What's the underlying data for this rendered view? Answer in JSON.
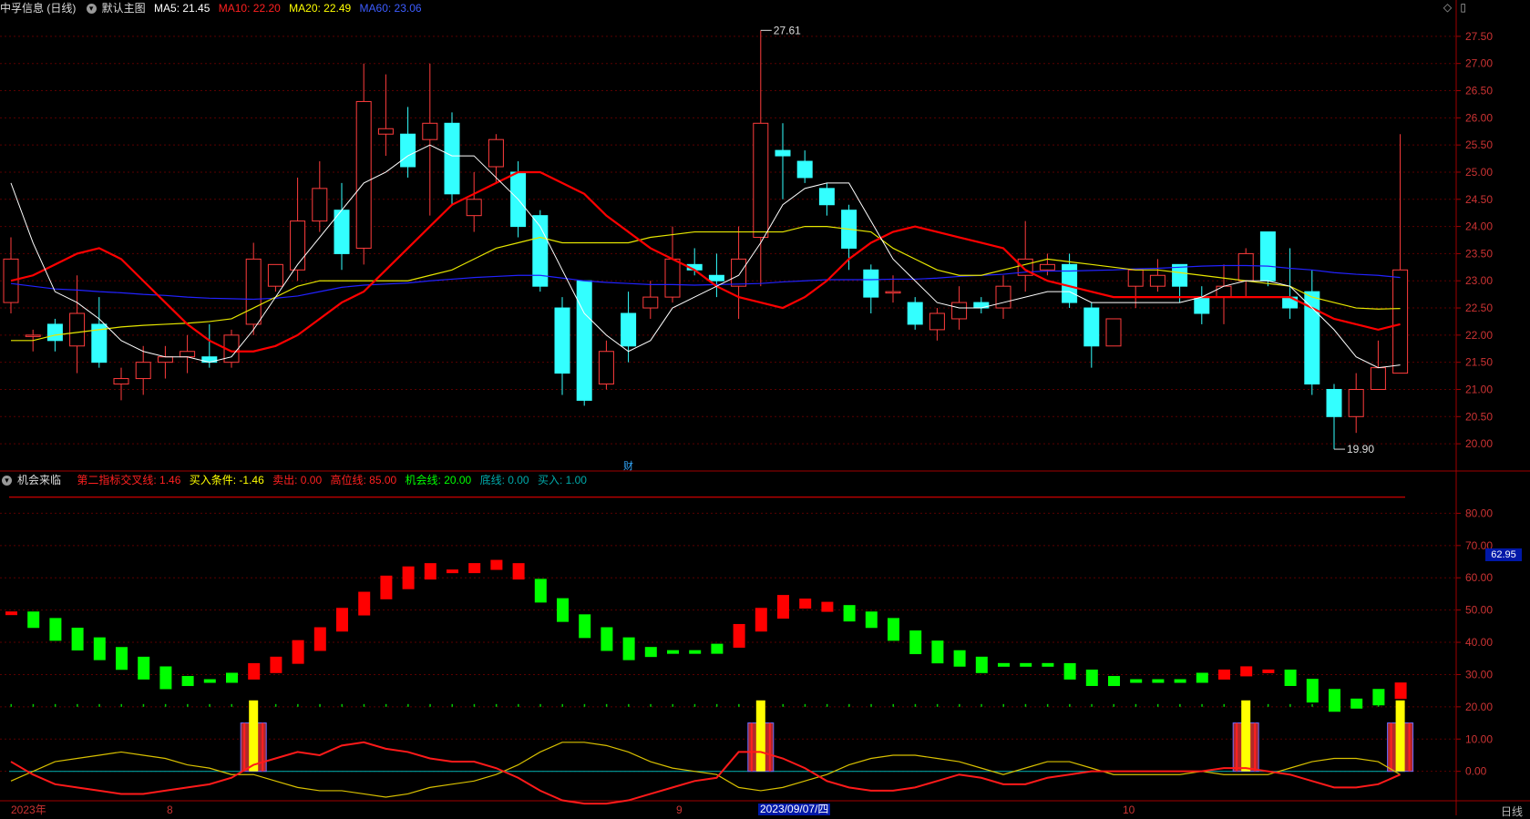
{
  "header": {
    "stock_title": "中孚信息 (日线)",
    "main_chart_label": "默认主图",
    "ma5": "MA5: 21.45",
    "ma10": "MA10: 22.20",
    "ma20": "MA20: 22.49",
    "ma60": "MA60: 23.06",
    "icons": [
      "diamond-icon",
      "window-icon"
    ]
  },
  "indicator_header": {
    "name": "机会来临",
    "cross_line": "第二指标交叉线: 1.46",
    "buy_condition": "买入条件: -1.46",
    "sell": "卖出: 0.00",
    "high_line": "高位线: 85.00",
    "chance_line": "机会线: 20.00",
    "bottom_line": "底线: 0.00",
    "buy": "买入: 1.00"
  },
  "price_axis": [
    "27.50",
    "27.00",
    "26.50",
    "26.00",
    "25.50",
    "25.00",
    "24.50",
    "24.00",
    "23.50",
    "23.00",
    "22.50",
    "22.00",
    "21.50",
    "21.00",
    "20.50",
    "20.00"
  ],
  "indicator_axis": [
    "80.00",
    "70.00",
    "60.00",
    "50.00",
    "40.00",
    "30.00",
    "20.00",
    "10.00",
    "0.00"
  ],
  "annotations": {
    "high": "27.61",
    "low": "19.90",
    "event_mark": "财",
    "current_value": "62.95"
  },
  "x_axis": {
    "labels": [
      "2023年",
      "8",
      "9",
      "10"
    ],
    "cursor_date": "2023/09/07/四",
    "period": "日线"
  },
  "colors": {
    "up": "#ff3c3c",
    "down": "#33ffff",
    "ma5": "#ffffff",
    "ma10": "#ff0000",
    "ma20": "#e6e600",
    "ma60": "#2222ff",
    "grid": "#5a0000",
    "ind_up": "#ff0000",
    "ind_down": "#00ff00"
  },
  "chart_data": {
    "type": "candlestick",
    "ylim": [
      19.7,
      27.8
    ],
    "candles": [
      [
        22.6,
        23.4,
        23.8,
        22.4
      ],
      [
        22.0,
        22.0,
        22.1,
        21.7
      ],
      [
        22.2,
        21.9,
        22.3,
        21.7
      ],
      [
        21.8,
        22.4,
        23.1,
        21.3
      ],
      [
        22.2,
        21.5,
        22.7,
        21.4
      ],
      [
        21.1,
        21.2,
        21.4,
        20.8
      ],
      [
        21.2,
        21.5,
        21.8,
        20.9
      ],
      [
        21.5,
        21.6,
        21.8,
        21.2
      ],
      [
        21.6,
        21.7,
        22.0,
        21.3
      ],
      [
        21.6,
        21.5,
        22.2,
        21.4
      ],
      [
        21.5,
        22.0,
        22.1,
        21.4
      ],
      [
        22.2,
        23.4,
        23.7,
        22.0
      ],
      [
        22.9,
        23.3,
        23.3,
        22.8
      ],
      [
        23.2,
        24.1,
        24.9,
        23.0
      ],
      [
        24.1,
        24.7,
        25.2,
        23.9
      ],
      [
        24.3,
        23.5,
        24.8,
        23.2
      ],
      [
        23.6,
        26.3,
        27.0,
        23.3
      ],
      [
        25.7,
        25.8,
        26.8,
        25.3
      ],
      [
        25.7,
        25.1,
        26.2,
        24.9
      ],
      [
        25.6,
        25.9,
        27.0,
        24.2
      ],
      [
        25.9,
        24.6,
        26.1,
        24.4
      ],
      [
        24.2,
        24.5,
        25.0,
        23.9
      ],
      [
        25.1,
        25.6,
        25.7,
        24.8
      ],
      [
        25.0,
        24.0,
        25.2,
        23.8
      ],
      [
        24.2,
        22.9,
        24.3,
        22.8
      ],
      [
        22.5,
        21.3,
        22.7,
        20.9
      ],
      [
        23.0,
        20.8,
        23.0,
        20.7
      ],
      [
        21.1,
        21.7,
        21.9,
        21.0
      ],
      [
        22.4,
        21.8,
        22.8,
        21.5
      ],
      [
        22.5,
        22.7,
        23.0,
        22.3
      ],
      [
        22.7,
        23.4,
        24.0,
        22.6
      ],
      [
        23.3,
        23.2,
        23.6,
        23.1
      ],
      [
        23.1,
        23.0,
        23.5,
        22.7
      ],
      [
        22.9,
        23.4,
        24.0,
        22.3
      ],
      [
        23.8,
        25.9,
        27.61,
        22.9
      ],
      [
        25.4,
        25.3,
        25.9,
        24.5
      ],
      [
        25.2,
        24.9,
        25.4,
        24.8
      ],
      [
        24.7,
        24.4,
        24.8,
        24.2
      ],
      [
        24.3,
        23.6,
        24.4,
        23.2
      ],
      [
        23.2,
        22.7,
        23.3,
        22.4
      ],
      [
        22.8,
        22.8,
        23.1,
        22.6
      ],
      [
        22.6,
        22.2,
        22.7,
        22.1
      ],
      [
        22.1,
        22.4,
        22.5,
        21.9
      ],
      [
        22.3,
        22.6,
        22.9,
        22.1
      ],
      [
        22.6,
        22.5,
        22.7,
        22.4
      ],
      [
        22.5,
        22.9,
        23.1,
        22.3
      ],
      [
        23.1,
        23.4,
        24.1,
        22.8
      ],
      [
        23.2,
        23.3,
        23.5,
        23.1
      ],
      [
        23.3,
        22.6,
        23.5,
        22.5
      ],
      [
        22.5,
        21.8,
        22.6,
        21.4
      ],
      [
        21.8,
        22.3,
        22.3,
        21.8
      ],
      [
        22.9,
        23.2,
        23.2,
        22.5
      ],
      [
        22.9,
        23.1,
        23.4,
        22.8
      ],
      [
        23.3,
        22.9,
        23.3,
        22.6
      ],
      [
        22.7,
        22.4,
        22.9,
        22.2
      ],
      [
        22.7,
        22.9,
        23.3,
        22.2
      ],
      [
        23.0,
        23.5,
        23.6,
        22.7
      ],
      [
        23.9,
        23.0,
        23.9,
        22.9
      ],
      [
        22.7,
        22.5,
        23.6,
        22.3
      ],
      [
        22.8,
        21.1,
        23.2,
        20.9
      ],
      [
        21.0,
        20.5,
        21.1,
        19.9
      ],
      [
        20.5,
        21.0,
        21.3,
        20.2
      ],
      [
        21.0,
        21.4,
        21.9,
        21.0
      ],
      [
        21.3,
        23.2,
        25.7,
        21.3
      ]
    ],
    "ma5": [
      24.8,
      23.7,
      22.8,
      22.6,
      22.3,
      21.9,
      21.7,
      21.6,
      21.6,
      21.5,
      21.6,
      22.1,
      22.7,
      23.3,
      23.8,
      24.3,
      24.8,
      25.0,
      25.3,
      25.5,
      25.3,
      25.3,
      24.9,
      24.5,
      24.0,
      23.2,
      22.4,
      22.0,
      21.7,
      21.9,
      22.5,
      22.7,
      22.9,
      23.1,
      23.7,
      24.4,
      24.7,
      24.8,
      24.8,
      24.1,
      23.4,
      23.0,
      22.6,
      22.5,
      22.5,
      22.6,
      22.7,
      22.8,
      22.8,
      22.6,
      22.6,
      22.6,
      22.6,
      22.6,
      22.7,
      22.9,
      23.0,
      23.0,
      22.9,
      22.5,
      22.1,
      21.6,
      21.4,
      21.45
    ],
    "ma10": [
      23.0,
      23.1,
      23.3,
      23.5,
      23.6,
      23.4,
      23.0,
      22.6,
      22.2,
      21.9,
      21.7,
      21.7,
      21.8,
      22.0,
      22.3,
      22.6,
      22.8,
      23.2,
      23.6,
      24.0,
      24.4,
      24.6,
      24.8,
      25.0,
      25.0,
      24.8,
      24.6,
      24.2,
      23.9,
      23.6,
      23.4,
      23.2,
      22.9,
      22.7,
      22.6,
      22.5,
      22.7,
      23.0,
      23.4,
      23.7,
      23.9,
      24.0,
      23.9,
      23.8,
      23.7,
      23.6,
      23.2,
      23.0,
      22.9,
      22.8,
      22.7,
      22.7,
      22.7,
      22.7,
      22.7,
      22.7,
      22.7,
      22.7,
      22.7,
      22.5,
      22.3,
      22.2,
      22.1,
      22.2
    ],
    "ma20": [
      21.9,
      21.9,
      22.0,
      22.05,
      22.1,
      22.15,
      22.18,
      22.2,
      22.22,
      22.25,
      22.3,
      22.5,
      22.7,
      22.9,
      23.0,
      23.0,
      23.0,
      23.0,
      23.0,
      23.1,
      23.2,
      23.4,
      23.6,
      23.7,
      23.8,
      23.7,
      23.7,
      23.7,
      23.7,
      23.8,
      23.85,
      23.9,
      23.9,
      23.9,
      23.9,
      23.9,
      24.0,
      24.0,
      23.95,
      23.9,
      23.6,
      23.4,
      23.2,
      23.1,
      23.1,
      23.2,
      23.3,
      23.4,
      23.35,
      23.3,
      23.25,
      23.2,
      23.2,
      23.15,
      23.1,
      23.05,
      23.0,
      22.95,
      22.9,
      22.7,
      22.6,
      22.5,
      22.48,
      22.49
    ],
    "ma60": [
      22.95,
      22.9,
      22.85,
      22.83,
      22.8,
      22.78,
      22.75,
      22.73,
      22.7,
      22.68,
      22.67,
      22.66,
      22.68,
      22.72,
      22.8,
      22.88,
      22.92,
      22.94,
      22.96,
      23.0,
      23.03,
      23.06,
      23.08,
      23.1,
      23.1,
      23.05,
      23.0,
      22.97,
      22.95,
      22.93,
      22.93,
      22.92,
      22.93,
      22.94,
      22.95,
      22.98,
      23.0,
      23.02,
      23.02,
      23.02,
      23.03,
      23.03,
      23.05,
      23.08,
      23.1,
      23.12,
      23.16,
      23.18,
      23.18,
      23.19,
      23.2,
      23.22,
      23.23,
      23.25,
      23.27,
      23.28,
      23.28,
      23.27,
      23.23,
      23.2,
      23.15,
      23.12,
      23.1,
      23.06
    ],
    "indicator": {
      "ylim": [
        -8,
        90
      ],
      "bars": [
        49,
        47,
        44,
        41,
        38,
        35,
        32,
        29,
        28,
        28,
        29,
        31,
        33,
        37,
        41,
        47,
        52,
        57,
        60,
        62,
        62,
        63,
        64,
        62,
        56,
        50,
        45,
        41,
        38,
        37,
        37,
        37,
        38,
        42,
        47,
        51,
        52,
        51,
        49,
        47,
        44,
        40,
        37,
        35,
        33,
        33,
        33,
        33,
        31,
        29,
        28,
        28,
        28,
        28,
        29,
        30,
        31,
        31,
        29,
        25,
        22,
        21,
        23,
        25
      ],
      "bar_up": [
        1,
        0,
        0,
        0,
        0,
        0,
        0,
        0,
        0,
        0,
        0,
        1,
        1,
        1,
        1,
        1,
        1,
        1,
        1,
        1,
        1,
        1,
        1,
        1,
        0,
        0,
        0,
        0,
        0,
        0,
        0,
        0,
        0,
        1,
        1,
        1,
        1,
        1,
        0,
        0,
        0,
        0,
        0,
        0,
        0,
        0,
        0,
        0,
        0,
        0,
        0,
        0,
        0,
        0,
        0,
        1,
        1,
        1,
        0,
        0,
        0,
        0,
        0,
        1
      ],
      "line_red": [
        3,
        -1,
        -4,
        -5,
        -6,
        -7,
        -7,
        -6,
        -5,
        -4,
        -2,
        2,
        4,
        6,
        5,
        8,
        9,
        7,
        6,
        4,
        3,
        3,
        1,
        -2,
        -6,
        -9,
        -10,
        -10,
        -9,
        -7,
        -5,
        -3,
        -2,
        6,
        6,
        4,
        1,
        -3,
        -5,
        -6,
        -6,
        -5,
        -3,
        -1,
        -2,
        -4,
        -4,
        -2,
        -1,
        0,
        0,
        0,
        0,
        0,
        0,
        1,
        1,
        0,
        -1,
        -3,
        -5,
        -5,
        -4,
        -1
      ],
      "line_yellow": [
        -3,
        0,
        3,
        4,
        5,
        6,
        5,
        4,
        2,
        1,
        -1,
        -1,
        -3,
        -5,
        -6,
        -6,
        -7,
        -8,
        -7,
        -5,
        -4,
        -3,
        -1,
        2,
        6,
        9,
        9,
        8,
        6,
        3,
        1,
        0,
        -1,
        -5,
        -6,
        -5,
        -3,
        -1,
        2,
        4,
        5,
        5,
        4,
        3,
        1,
        -1,
        1,
        3,
        3,
        1,
        -1,
        -1,
        -1,
        -1,
        0,
        -1,
        -1,
        -1,
        1,
        3,
        4,
        4,
        3,
        -1
      ],
      "signals": [
        11,
        34,
        56,
        63
      ]
    }
  }
}
